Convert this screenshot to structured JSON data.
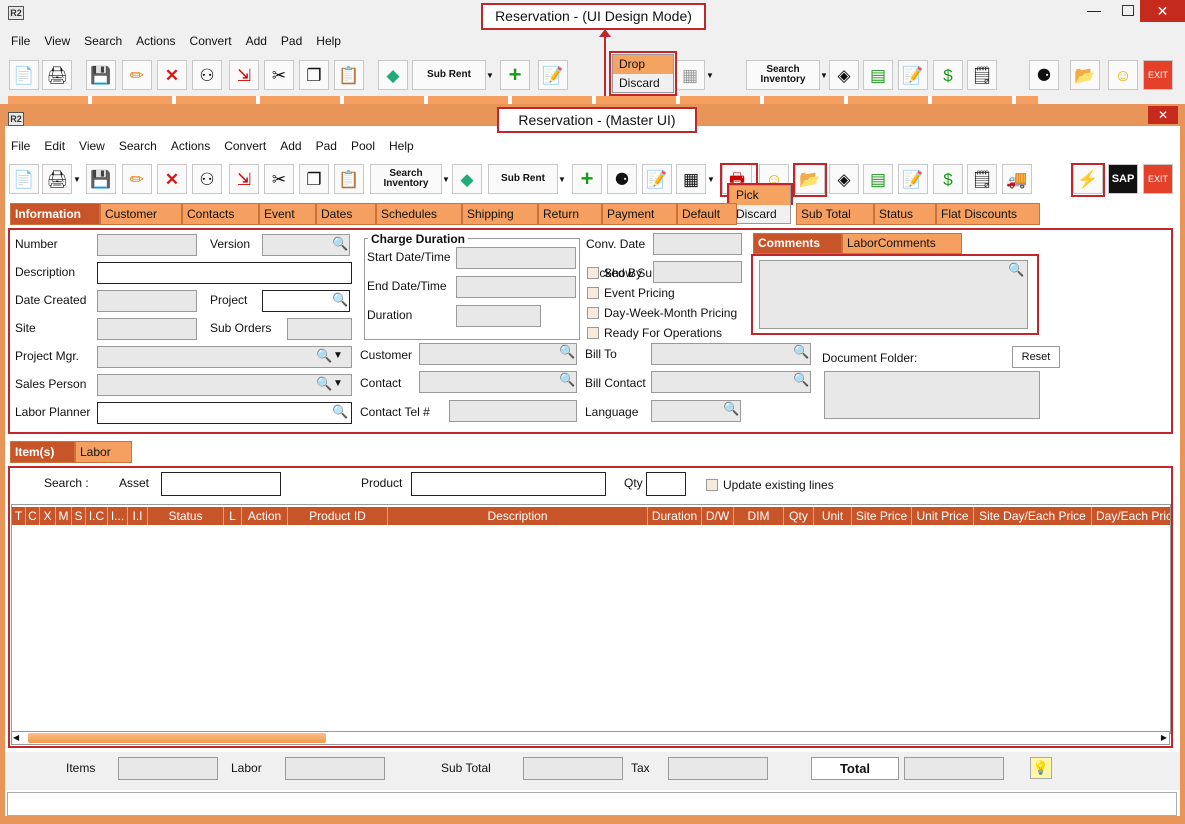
{
  "outer": {
    "title": "Reservation - (UI Design Mode)",
    "logo": "R2",
    "menu": [
      "File",
      "View",
      "Search",
      "Actions",
      "Convert",
      "Add",
      "Pad",
      "Help"
    ],
    "popup": {
      "items": [
        "Drop",
        "Discard"
      ]
    },
    "toolbar": {
      "search_inventory": "Search\nInventory",
      "sub_rent": "Sub Rent",
      "exit": "EXIT"
    }
  },
  "inner": {
    "title": "Reservation - (Master UI)",
    "logo": "R2",
    "close": "✕",
    "menu": [
      "File",
      "Edit",
      "View",
      "Search",
      "Actions",
      "Convert",
      "Add",
      "Pad",
      "Pool",
      "Help"
    ],
    "popup": {
      "items": [
        "Pick",
        "Discard"
      ]
    },
    "toolbar": {
      "search_inventory": "Search\nInventory",
      "sub_rent": "Sub Rent",
      "sap": "SAP",
      "exit": "EXIT"
    },
    "tabs": [
      "Information",
      "Customer",
      "Contacts",
      "Event",
      "Dates",
      "Schedules",
      "Shipping",
      "Return",
      "Payment",
      "Default",
      "Sub Total",
      "Status",
      "Flat Discounts"
    ],
    "info": {
      "number": "Number",
      "version": "Version",
      "description": "Description",
      "date_created": "Date Created",
      "project": "Project",
      "site": "Site",
      "sub_orders": "Sub Orders",
      "project_mgr": "Project Mgr.",
      "sales_person": "Sales Person",
      "labor_planner": "Labor Planner",
      "charge_duration": "Charge Duration",
      "start": "Start Date/Time",
      "end": "End Date/Time",
      "duration": "Duration",
      "customer": "Customer",
      "contact": "Contact",
      "contact_tel": "Contact Tel #",
      "conv_date": "Conv. Date",
      "locked_by": "Locked By",
      "show_sub": "Show Su",
      "event_pricing": "Event Pricing",
      "dwm_pricing": "Day-Week-Month Pricing",
      "ready": "Ready For Operations",
      "bill_to": "Bill To",
      "bill_contact": "Bill Contact",
      "language": "Language",
      "comments_tab": "Comments",
      "labor_comments_tab": "LaborComments",
      "document_folder": "Document Folder:",
      "reset": "Reset"
    },
    "items_tabs": [
      "Item(s)",
      "Labor"
    ],
    "items": {
      "search": "Search :",
      "asset": "Asset",
      "product": "Product",
      "qty": "Qty",
      "update_existing": "Update existing lines",
      "columns": [
        "T",
        "C",
        "X",
        "M",
        "S",
        "I.C",
        "I...",
        "I.I",
        "Status",
        "L",
        "Action",
        "Product ID",
        "Description",
        "Duration",
        "D/W",
        "DIM",
        "Qty",
        "Unit",
        "Site Price",
        "Unit Price",
        "Site Day/Each Price",
        "Day/Each Price"
      ]
    },
    "footer": {
      "items": "Items",
      "labor": "Labor",
      "sub_total": "Sub Total",
      "tax": "Tax",
      "total": "Total"
    }
  }
}
